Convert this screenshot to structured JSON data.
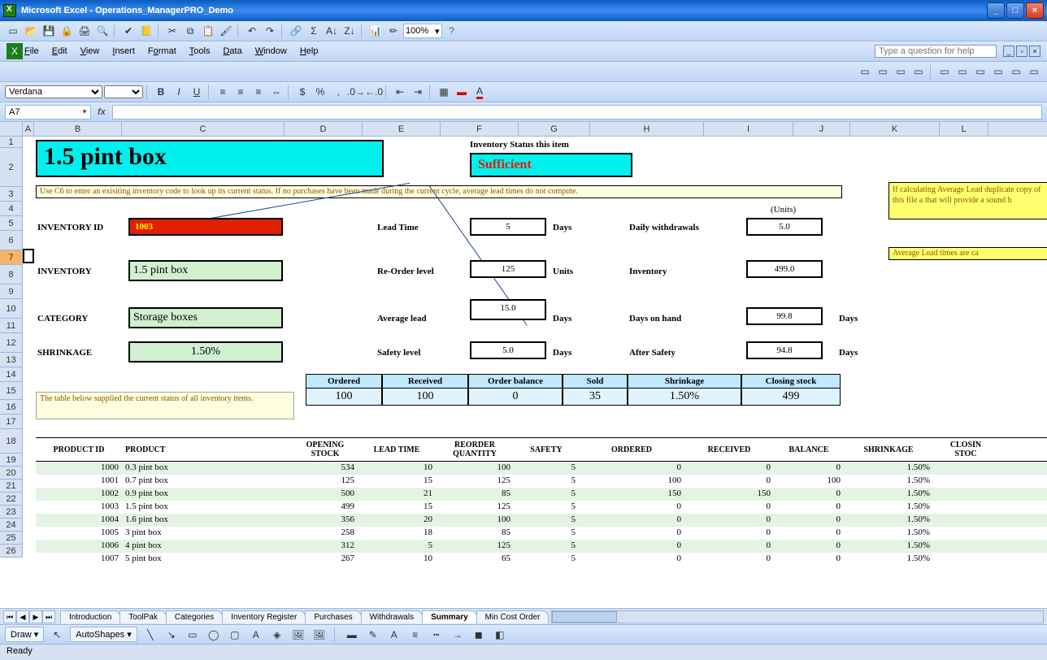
{
  "titlebar": {
    "app": "Microsoft Excel",
    "doc": "Operations_ManagerPRO_Demo"
  },
  "menu": [
    "File",
    "Edit",
    "View",
    "Insert",
    "Format",
    "Tools",
    "Data",
    "Window",
    "Help"
  ],
  "help_placeholder": "Type a question for help",
  "font": {
    "name": "Verdana",
    "size": ""
  },
  "namebox": "A7",
  "zoom": "100%",
  "columns": [
    "A",
    "B",
    "C",
    "D",
    "E",
    "F",
    "G",
    "H",
    "I",
    "J",
    "K",
    "L"
  ],
  "rows": [
    "1",
    "2",
    "3",
    "4",
    "5",
    "6",
    "7",
    "8",
    "9",
    "10",
    "11",
    "12",
    "13",
    "14",
    "15",
    "16",
    "17",
    "18",
    "19",
    "20",
    "21",
    "22",
    "23",
    "24",
    "25",
    "26"
  ],
  "big_title": "1.5 pint box",
  "inv_status_label": "Inventory Status this item",
  "inv_status_value": "Sufficient",
  "yellow_note": "Use C6 to enter an exisiting inventory code to look up its current status. If no purchases have been made during the current cycle, average lead times do not compute.",
  "yellow_side": "If calculating Average Lead duplicate copy of this file a that will provide a sound b",
  "yellow_side2": "Average Lead times are ca",
  "units_label": "(Units)",
  "labels": {
    "inventory_id": "INVENTORY ID",
    "inventory": "INVENTORY",
    "category": "CATEGORY",
    "shrinkage": "SHRINKAGE",
    "lead_time": "Lead Time",
    "reorder_level": "Re-Order level",
    "average_lead": "Average lead",
    "safety_level": "Safety level",
    "daily_withdrawals": "Daily withdrawals",
    "inventory_qty": "Inventory",
    "days_on_hand": "Days on hand",
    "after_safety": "After Safety",
    "days": "Days",
    "units": "Units"
  },
  "values": {
    "inventory_id": "1003",
    "inventory": "1.5 pint box",
    "category": "Storage boxes",
    "shrinkage": "1.50%",
    "lead_time": "5",
    "reorder_level": "125",
    "average_lead": "15.0",
    "safety_level": "5.0",
    "daily_withdrawals": "5.0",
    "inventory_qty": "499.0",
    "days_on_hand": "99.8",
    "after_safety": "94.8"
  },
  "summary": {
    "headers": [
      "Ordered",
      "Received",
      "Order balance",
      "Sold",
      "Shrinkage",
      "Closing stock"
    ],
    "values": [
      "100",
      "100",
      "0",
      "35",
      "1.50%",
      "499"
    ]
  },
  "table_note": "The table below supplied the current status of all inventory items.",
  "table": {
    "headers": [
      "PRODUCT ID",
      "PRODUCT",
      "OPENING STOCK",
      "LEAD TIME",
      "REORDER QUANTITY",
      "SAFETY",
      "ORDERED",
      "RECEIVED",
      "BALANCE",
      "SHRINKAGE",
      "CLOSING STOCK"
    ],
    "rows": [
      {
        "pid": "1000",
        "prod": "0.3 pint box",
        "os": "534",
        "lt": "10",
        "rq": "100",
        "sf": "5",
        "ord": "0",
        "rec": "0",
        "bal": "0",
        "shr": "1.50%"
      },
      {
        "pid": "1001",
        "prod": "0.7 pint box",
        "os": "125",
        "lt": "15",
        "rq": "125",
        "sf": "5",
        "ord": "100",
        "rec": "0",
        "bal": "100",
        "shr": "1.50%"
      },
      {
        "pid": "1002",
        "prod": "0.9 pint box",
        "os": "500",
        "lt": "21",
        "rq": "85",
        "sf": "5",
        "ord": "150",
        "rec": "150",
        "bal": "0",
        "shr": "1.50%"
      },
      {
        "pid": "1003",
        "prod": "1.5 pint box",
        "os": "499",
        "lt": "15",
        "rq": "125",
        "sf": "5",
        "ord": "0",
        "rec": "0",
        "bal": "0",
        "shr": "1.50%"
      },
      {
        "pid": "1004",
        "prod": "1.6 pint box",
        "os": "356",
        "lt": "20",
        "rq": "100",
        "sf": "5",
        "ord": "0",
        "rec": "0",
        "bal": "0",
        "shr": "1.50%"
      },
      {
        "pid": "1005",
        "prod": "3 pint box",
        "os": "258",
        "lt": "18",
        "rq": "85",
        "sf": "5",
        "ord": "0",
        "rec": "0",
        "bal": "0",
        "shr": "1.50%"
      },
      {
        "pid": "1006",
        "prod": "4 pint box",
        "os": "312",
        "lt": "5",
        "rq": "125",
        "sf": "5",
        "ord": "0",
        "rec": "0",
        "bal": "0",
        "shr": "1.50%"
      },
      {
        "pid": "1007",
        "prod": "5 pint box",
        "os": "267",
        "lt": "10",
        "rq": "65",
        "sf": "5",
        "ord": "0",
        "rec": "0",
        "bal": "0",
        "shr": "1.50%"
      }
    ]
  },
  "sheet_tabs": [
    "Introduction",
    "ToolPak",
    "Categories",
    "Inventory Register",
    "Purchases",
    "Withdrawals",
    "Summary",
    "Min Cost Order"
  ],
  "active_tab": "Summary",
  "draw": {
    "label": "Draw",
    "autoshapes": "AutoShapes"
  },
  "status": "Ready"
}
